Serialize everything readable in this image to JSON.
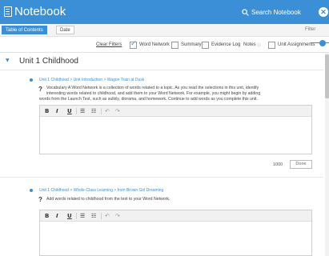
{
  "header": {
    "title": "Notebook",
    "search_label": "Search Notebook",
    "close_icon": "close-icon"
  },
  "tabs": [
    {
      "label": "Table of Contents",
      "active": true
    },
    {
      "label": "Date",
      "active": false
    }
  ],
  "filter_link": "Filter",
  "filters": {
    "clear": "Clear Filters",
    "items": [
      {
        "label": "Word Network",
        "checked": true
      },
      {
        "label": "Summary",
        "checked": false
      },
      {
        "label": "Evidence Log",
        "checked": false
      },
      {
        "label": "Notes",
        "checked": false
      },
      {
        "label": "Unit Assignments",
        "checked": false
      }
    ],
    "info_glyph": "ⓘ"
  },
  "unit": {
    "title": "Unit 1 Childhood"
  },
  "entries": [
    {
      "crumb": "Unit 1 Childhood > Unit Introduction > Wagon Train at Dusk",
      "prompt_lines": [
        "Vocabulary A Word Network is a collection of words related to a topic. As you read the selections in this unit, identify",
        "interesting words related to childhood, and add them to your Word Network. For example, you might begin by adding",
        "words from the Launch Text, such as sulkily, diorama, and homework. Continue to add words as you complete this unit."
      ],
      "char_count": "1000",
      "done_label": "Done"
    },
    {
      "crumb": "Unit 1 Childhood > Whole-Class Learning > from Brown Girl Dreaming",
      "prompt_lines": [
        "Add words related to childhood from the text to your Word Network."
      ]
    }
  ],
  "toolbar": {
    "bold": "B",
    "italic": "I",
    "underline": "U",
    "bullets": "☰",
    "numbered": "☷",
    "undo": "↶",
    "redo": "↷",
    "qmark": "?"
  },
  "colors": {
    "accent": "#3b8fd6"
  }
}
